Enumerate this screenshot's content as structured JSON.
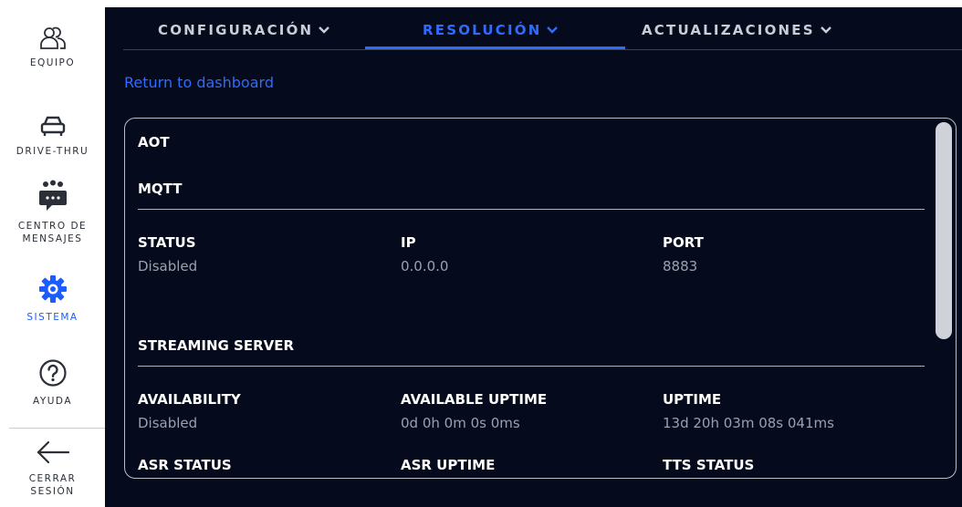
{
  "sidebar": {
    "items": [
      {
        "label": "EQUIPO",
        "icon": "team-icon"
      },
      {
        "label": "DRIVE-THRU",
        "icon": "car-icon"
      },
      {
        "label": "CENTRO DE\nMENSAJES",
        "label_lines": [
          "CENTRO DE",
          "MENSAJES"
        ],
        "icon": "message-center-icon"
      },
      {
        "label": "SISTEMA",
        "icon": "gear-icon",
        "active": true
      },
      {
        "label": "AYUDA",
        "icon": "help-icon"
      },
      {
        "label_lines": [
          "CERRAR",
          "SESIÓN"
        ],
        "icon": "logout-arrow-icon"
      }
    ],
    "active_color": "#1a5cff"
  },
  "tabs": [
    {
      "label": "CONFIGURACIÓN"
    },
    {
      "label": "RESOLUCIÓN",
      "active": true
    },
    {
      "label": "ACTUALIZACIONES"
    }
  ],
  "return_link": "Return to dashboard",
  "card": {
    "section_aot": "AOT",
    "section_mqtt": "MQTT",
    "mqtt": {
      "status_label": "STATUS",
      "status_value": "Disabled",
      "ip_label": "IP",
      "ip_value": "0.0.0.0",
      "port_label": "PORT",
      "port_value": "8883"
    },
    "section_streaming": "STREAMING SERVER",
    "streaming": {
      "availability_label": "AVAILABILITY",
      "availability_value": "Disabled",
      "available_uptime_label": "AVAILABLE UPTIME",
      "available_uptime_value": "0d 0h 0m 0s 0ms",
      "uptime_label": "UPTIME",
      "uptime_value": "13d 20h 03m 08s 041ms",
      "asr_status_label": "ASR STATUS",
      "asr_uptime_label": "ASR UPTIME",
      "tts_status_label": "TTS STATUS"
    }
  },
  "colors": {
    "background": "#050b1c",
    "accent": "#2f6bff",
    "text_primary": "#ffffff",
    "text_secondary": "#9aa1ad"
  }
}
